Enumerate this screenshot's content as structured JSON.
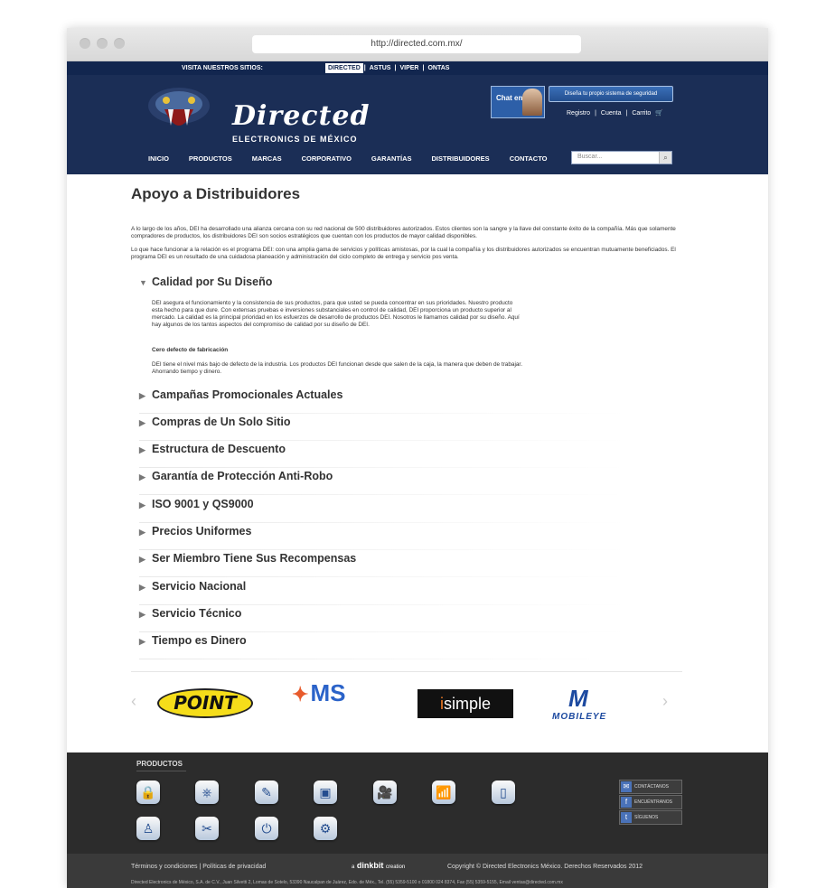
{
  "browser": {
    "url": "http://directed.com.mx/"
  },
  "topbar": {
    "label": "VISITA NUESTROS SITIOS:",
    "sites": [
      "DIRECTED",
      "ASTUS",
      "VIPER",
      "ONTAS"
    ],
    "separator": "|"
  },
  "header": {
    "brand": "Directed",
    "brand_sub": "ELECTRONICS DE MÉXICO",
    "chat_label": "Chat en Vivo",
    "design_button": "Diseña tu propio sistema de seguridad",
    "links": [
      "Registro",
      "Cuenta",
      "Carrito"
    ],
    "link_separator": "|",
    "search_placeholder": "Buscar...",
    "nav": [
      "INICIO",
      "PRODUCTOS",
      "MARCAS",
      "CORPORATIVO",
      "GARANTÍAS",
      "DISTRIBUIDORES",
      "CONTACTO"
    ]
  },
  "main": {
    "title": "Apoyo a Distribuidores",
    "intro_1": "A lo largo de los años, DEI ha desarrollado una alianza cercana con su red nacional de 500 distribuidores autorizados. Estos clientes son la sangre y la llave del constante éxito de la compañía. Más que solamente compradores de productos, los distribuidores DEI son socios estratégicos que cuentan con los productos de mayor calidad disponibles.",
    "intro_2": "Lo que hace funcionar a la relación es el programa DEI: con una amplia gama de servicios y políticas amistosas, por la cual la compañía y los distribuidores autorizados se encuentran mutuamente beneficiados. El programa DEI es un resultado de una cuidadosa planeación y administración del ciclo completo de entrega y servicio pos venta.",
    "open_section": {
      "title": "Calidad por Su Diseño",
      "body": "DEI asegura el funcionamiento y la consistencia de sus productos, para que usted se pueda concentrar en sus prioridades. Nuestro producto esta hecho para que dure. Con extensas pruebas e inversiones substanciales en control de calidad, DEI proporciona un producto superior al mercado. La calidad es la principal prioridad en los esfuerzos de desarrollo de productos DEI. Nosotros le llamamos calidad por su diseño. Aquí hay algunos de los tantos aspectos del compromiso de calidad por su diseño de DEI.",
      "subhead": "Cero defecto de fabricación",
      "sub_body": "DEI tiene el nivel más bajo de defecto de la industria. Los productos DEI funcionan desde que salen de la caja, la manera que deben de trabajar. Ahorrando tiempo y dinero."
    },
    "sections": [
      "Campañas Promocionales Actuales",
      "Compras de Un Solo Sitio",
      "Estructura de Descuento",
      "Garantía de Protección Anti-Robo",
      "ISO 9001 y QS9000",
      "Precios Uniformes",
      "Ser Miembro Tiene Sus Recompensas",
      "Servicio Nacional",
      "Servicio Técnico",
      "Tiempo es Dinero"
    ],
    "brands": {
      "point": "POINT",
      "ms": "MS",
      "isimple_prefix": "i",
      "isimple": "simple",
      "mobileye_mark": "M",
      "mobileye": "MOBILEYE"
    }
  },
  "footer": {
    "products_label": "PRODUCTOS",
    "icons": [
      "lock-icon",
      "steering-icon",
      "usb-icon",
      "remote-icon",
      "camera-icon",
      "signal-icon",
      "ipod-icon",
      "seat-icon",
      "tools-icon",
      "power-icon",
      "gears-icon"
    ],
    "social": [
      "CONTÁCTANOS",
      "ENCUÉNTRANOS",
      "SÍGUENOS"
    ],
    "legal_links": "Términos y condiciones | Políticas de privacidad",
    "credit_prefix": "a",
    "credit_brand": "dinkbit",
    "credit_suffix": "creation",
    "copyright": "Copyright © Directed Electronics México. Derechos Reservados 2012",
    "address": "Directed Electronics de México, S.A. de C.V., Juan Silvetti 2, Lomas de Sotelo, 53390 Naucalpan de Juárez, Edo. de Méx., Tel. (55) 5359-5100 o 01800 024 8374, Fax (55) 5359-5155, Email ventas@directed.com.mx"
  }
}
